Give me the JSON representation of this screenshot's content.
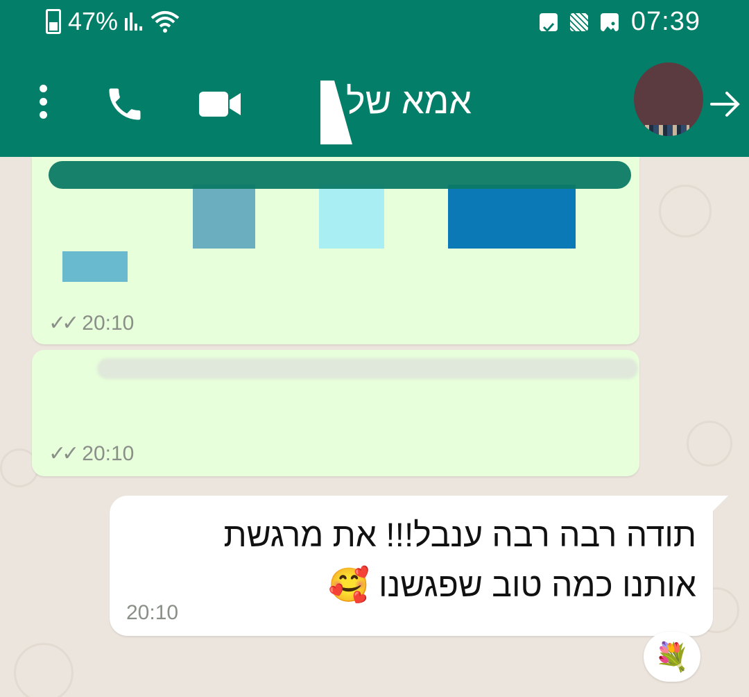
{
  "status_bar": {
    "battery": "47%",
    "time": "07:39"
  },
  "header": {
    "title": "אמא של",
    "colors": {
      "bar": "#037e69"
    }
  },
  "messages": [
    {
      "type": "outgoing",
      "content": "chart-image",
      "time": "20:10",
      "bars": [
        {
          "color": "#69b9cf"
        },
        {
          "color": "#6aaebf"
        },
        {
          "color": "#a8eef3"
        },
        {
          "color": "#0b79b5"
        }
      ]
    },
    {
      "type": "outgoing",
      "content": "redacted-text",
      "time": "20:10"
    },
    {
      "type": "incoming",
      "text_line1": "תודה רבה רבה ענבל!!! את מרגשת",
      "text_line2": "אותנו כמה טוב שפגשנו",
      "emoji": "🥰",
      "time": "20:10",
      "reaction": "💐"
    }
  ]
}
